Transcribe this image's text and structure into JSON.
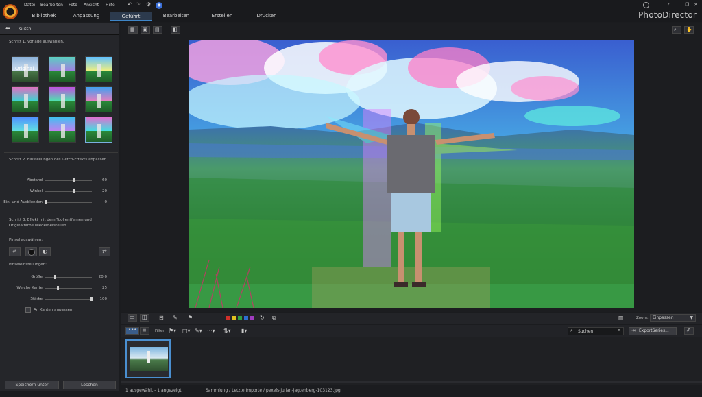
{
  "app": {
    "brand": "PhotoDirector"
  },
  "menu": [
    "Datei",
    "Bearbeiten",
    "Foto",
    "Ansicht",
    "Hilfe"
  ],
  "tabs": [
    {
      "label": "Bibliothek"
    },
    {
      "label": "Anpassung"
    },
    {
      "label": "Geführt"
    },
    {
      "label": "Bearbeiten"
    },
    {
      "label": "Erstellen"
    },
    {
      "label": "Drucken"
    }
  ],
  "active_tab": "Geführt",
  "window_controls": [
    "?",
    "–",
    "❐",
    "✕"
  ],
  "left_panel": {
    "title": "Glitch",
    "step1": "Schritt 1. Vorlage auswählen.",
    "original_label": "Original",
    "step2": "Schritt 2. Einstellungen des Glitch-Effekts anpassen.",
    "sliders": [
      {
        "label": "Abstand",
        "value": "60",
        "fraction": 0.6
      },
      {
        "label": "Winkel",
        "value": "20",
        "fraction": 0.6
      },
      {
        "label": "Ein- und Ausblenden",
        "value": "0",
        "fraction": 0.0
      }
    ],
    "step3_line1": "Schritt 3. Effekt mit dem Tool entfernen und",
    "step3_line2": "Originalfarbe wiederherstellen.",
    "brush_select_label": "Pinsel auswählen:",
    "brush_settings_label": "Pinseleinstellungen:",
    "brush_sliders": [
      {
        "label": "Größe",
        "value": "20.0",
        "fraction": 0.2
      },
      {
        "label": "Weiche Kante",
        "value": "25",
        "fraction": 0.25
      },
      {
        "label": "Stärke",
        "value": "100",
        "fraction": 1.0
      }
    ],
    "edge_checkbox": "An Kanten anpassen",
    "save_button": "Speichern unter",
    "delete_button": "Löschen"
  },
  "bottom": {
    "zoom_label": "Zoom:",
    "zoom_value": "Einpassen",
    "filter_label": "Filter:",
    "search_placeholder": "Suchen",
    "export_button": "ExportSeries...",
    "color_labels": [
      "#d0302a",
      "#e0c020",
      "#2fa040",
      "#2d6fd0",
      "#a03cc0"
    ]
  },
  "status": {
    "selection": "1 ausgewählt - 1 angezeigt",
    "path": "Sammlung / Letzte Importe / pexels-julian-jagtenberg-103123.jpg"
  }
}
